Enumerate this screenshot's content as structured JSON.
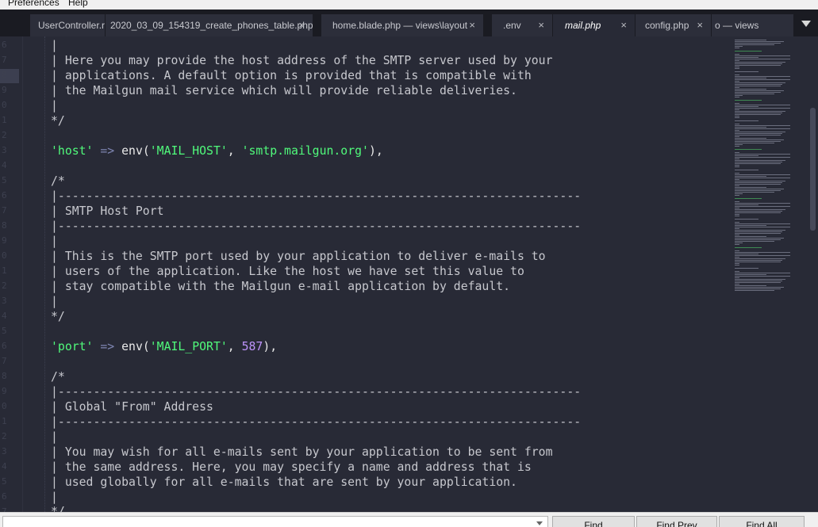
{
  "menu": [
    "Preferences",
    "Help"
  ],
  "tabs": [
    {
      "label": "UserController.r",
      "close": "×",
      "active": false
    },
    {
      "label": "2020_03_09_154319_create_phones_table.php",
      "close": "×",
      "active": false
    },
    {
      "label": "home.blade.php — views\\layout",
      "close": "×",
      "active": false
    },
    {
      "label": ".env",
      "close": "×",
      "active": false
    },
    {
      "label": "mail.php",
      "close": "×",
      "active": true
    },
    {
      "label": "config.php",
      "close": "×",
      "active": false
    },
    {
      "label": "o — views",
      "close": "",
      "active": false
    }
  ],
  "code": {
    "l1": "|",
    "l2": "| Here you may provide the host address of the SMTP server used by your",
    "l3": "| applications. A default option is provided that is compatible with",
    "l4": "| the Mailgun mail service which will provide reliable deliveries.",
    "l5": "|",
    "l6": "*/",
    "host_key": "'host'",
    "arrow": "=>",
    "env_fn": "env(",
    "host_env": "'MAIL_HOST'",
    "comma": ", ",
    "host_default": "'smtp.mailgun.org'",
    "close": "),",
    "c_open": "/*",
    "rule": "|--------------------------------------------------------------------------",
    "s1_title": "| SMTP Host Port",
    "bar": "|",
    "s1_d1": "| This is the SMTP port used by your application to deliver e-mails to",
    "s1_d2": "| users of the application. Like the host we have set this value to",
    "s1_d3": "| stay compatible with the Mailgun e-mail application by default.",
    "c_close": "*/",
    "port_key": "'port'",
    "port_env": "'MAIL_PORT'",
    "port_default": "587",
    "s2_title": "| Global \"From\" Address",
    "s2_d1": "| You may wish for all e-mails sent by your application to be sent from",
    "s2_d2": "| the same address. Here, you may specify a name and address that is",
    "s2_d3": "| used globally for all e-mails that are sent by your application.",
    "last": "*/"
  },
  "find": {
    "buttons": [
      "Find",
      "Find Prev",
      "Find All"
    ]
  }
}
